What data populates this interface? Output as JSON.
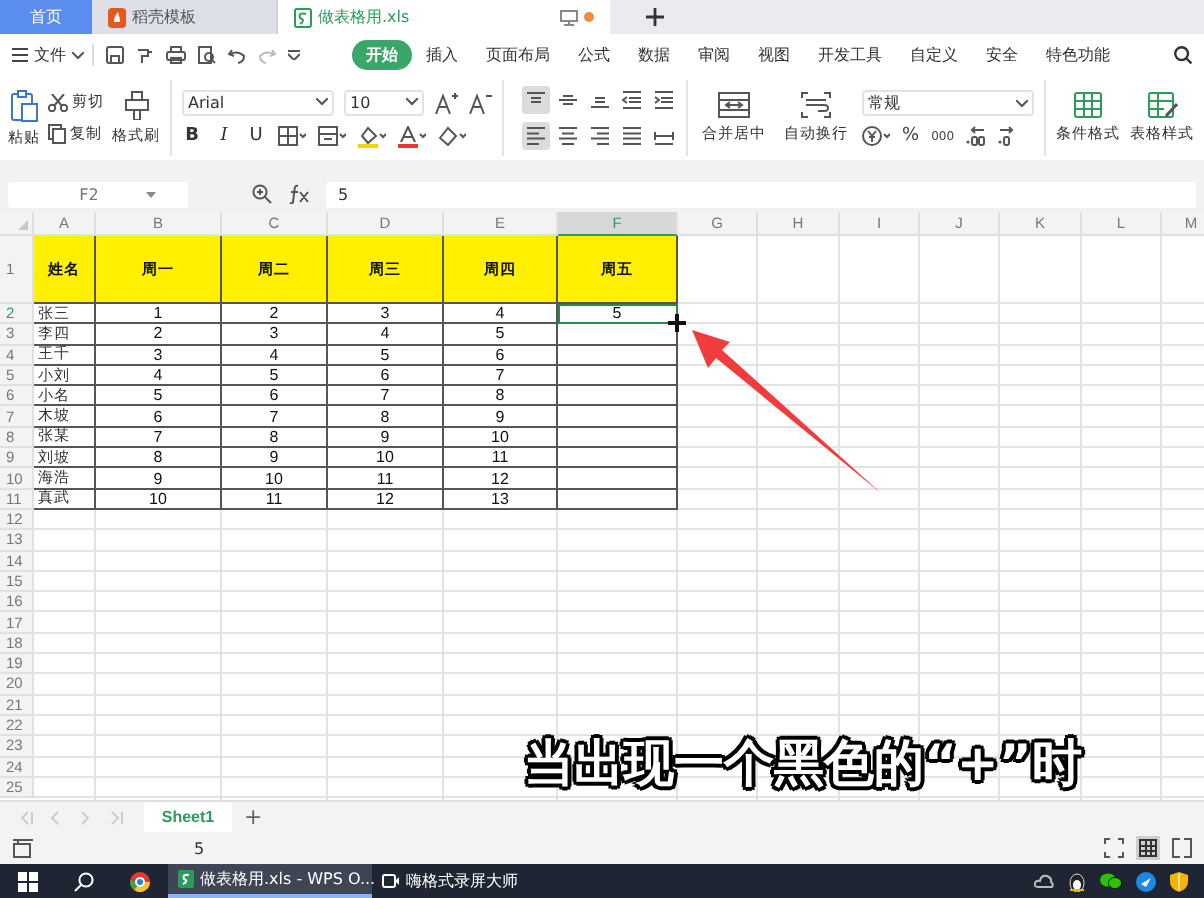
{
  "tabs": [
    {
      "label": "首页",
      "kind": "home",
      "selected": false
    },
    {
      "label": "稻壳模板",
      "kind": "template",
      "selected": false
    },
    {
      "label": "做表格用.xls",
      "kind": "sheet",
      "selected": true,
      "modified": true
    }
  ],
  "menu": {
    "file": "文件",
    "ribbon_tabs": [
      {
        "label": "开始",
        "selected": true
      },
      {
        "label": "插入",
        "selected": false
      },
      {
        "label": "页面布局",
        "selected": false
      },
      {
        "label": "公式",
        "selected": false
      },
      {
        "label": "数据",
        "selected": false
      },
      {
        "label": "审阅",
        "selected": false
      },
      {
        "label": "视图",
        "selected": false
      },
      {
        "label": "开发工具",
        "selected": false
      },
      {
        "label": "自定义",
        "selected": false
      },
      {
        "label": "安全",
        "selected": false
      },
      {
        "label": "特色功能",
        "selected": false
      }
    ]
  },
  "ribbon": {
    "paste": "粘贴",
    "cut": "剪切",
    "copy": "复制",
    "format_painter": "格式刷",
    "font": "Arial",
    "font_size": "10",
    "style_buttons": [
      {
        "label": "B",
        "kind": "bold"
      },
      {
        "label": "I",
        "kind": "italic"
      },
      {
        "label": "U",
        "kind": "underline"
      }
    ],
    "align_buttons": [
      {
        "kind": "top",
        "selected": true
      },
      {
        "kind": "middle",
        "selected": false
      },
      {
        "kind": "bottom",
        "selected": false
      },
      {
        "kind": "outdent",
        "selected": false
      },
      {
        "kind": "indent",
        "selected": false
      },
      {
        "kind": "left",
        "selected": true
      },
      {
        "kind": "center",
        "selected": false
      },
      {
        "kind": "right",
        "selected": false
      },
      {
        "kind": "justify",
        "selected": false
      },
      {
        "kind": "distribute",
        "selected": false
      }
    ],
    "merge": "合并居中",
    "wrap": "自动换行",
    "number_format": "常规",
    "percent": "%",
    "thousands": "000",
    "conditional_format": "条件格式",
    "table_style": "表格样式"
  },
  "formula_bar": {
    "name_box": "F2",
    "formula": "5"
  },
  "table": {
    "columns": [
      {
        "label": "A",
        "selected": false
      },
      {
        "label": "B",
        "selected": false
      },
      {
        "label": "C",
        "selected": false
      },
      {
        "label": "D",
        "selected": false
      },
      {
        "label": "E",
        "selected": false
      },
      {
        "label": "F",
        "selected": true
      },
      {
        "label": "G",
        "selected": false
      },
      {
        "label": "H",
        "selected": false
      },
      {
        "label": "I",
        "selected": false
      },
      {
        "label": "J",
        "selected": false
      },
      {
        "label": "K",
        "selected": false
      },
      {
        "label": "L",
        "selected": false
      },
      {
        "label": "M",
        "selected": false
      }
    ],
    "rows": [
      {
        "label": "1",
        "selected": false,
        "kind": "header",
        "cells": [
          "姓名",
          "周一",
          "周二",
          "周三",
          "周四",
          "周五"
        ]
      },
      {
        "label": "2",
        "selected": true,
        "kind": "data",
        "cells": [
          "张三",
          "1",
          "2",
          "3",
          "4",
          "5"
        ]
      },
      {
        "label": "3",
        "selected": false,
        "kind": "data",
        "cells": [
          "李四",
          "2",
          "3",
          "4",
          "5"
        ]
      },
      {
        "label": "4",
        "selected": false,
        "kind": "data",
        "cells": [
          "王千",
          "3",
          "4",
          "5",
          "6"
        ]
      },
      {
        "label": "5",
        "selected": false,
        "kind": "data",
        "cells": [
          "小刘",
          "4",
          "5",
          "6",
          "7"
        ]
      },
      {
        "label": "6",
        "selected": false,
        "kind": "data",
        "cells": [
          "小名",
          "5",
          "6",
          "7",
          "8"
        ]
      },
      {
        "label": "7",
        "selected": false,
        "kind": "data",
        "cells": [
          "木坡",
          "6",
          "7",
          "8",
          "9"
        ]
      },
      {
        "label": "8",
        "selected": false,
        "kind": "data",
        "cells": [
          "张某",
          "7",
          "8",
          "9",
          "10"
        ]
      },
      {
        "label": "9",
        "selected": false,
        "kind": "data",
        "cells": [
          "刘坡",
          "8",
          "9",
          "10",
          "11"
        ]
      },
      {
        "label": "10",
        "selected": false,
        "kind": "data",
        "cells": [
          "海浩",
          "9",
          "10",
          "11",
          "12"
        ]
      },
      {
        "label": "11",
        "selected": false,
        "kind": "data",
        "cells": [
          "真武",
          "10",
          "11",
          "12",
          "13"
        ]
      },
      {
        "label": "12",
        "selected": false
      },
      {
        "label": "13",
        "selected": false
      },
      {
        "label": "14",
        "selected": false
      },
      {
        "label": "15",
        "selected": false
      },
      {
        "label": "16",
        "selected": false
      },
      {
        "label": "17",
        "selected": false
      },
      {
        "label": "18",
        "selected": false
      },
      {
        "label": "19",
        "selected": false
      },
      {
        "label": "20",
        "selected": false
      },
      {
        "label": "21",
        "selected": false
      },
      {
        "label": "22",
        "selected": false
      },
      {
        "label": "23",
        "selected": false
      },
      {
        "label": "24",
        "selected": false
      },
      {
        "label": "25",
        "selected": false
      }
    ]
  },
  "caption": "当出现一个黑色的“+”时",
  "sheet_tabs": [
    {
      "label": "Sheet1",
      "selected": true
    }
  ],
  "add_sheet": "+",
  "status_bar": {
    "value": "5"
  },
  "taskbar": {
    "items": [
      {
        "label": "做表格用.xls - WPS O...",
        "kind": "wps",
        "selected": true
      },
      {
        "label": "嗨格式录屏大师",
        "kind": "recorder",
        "selected": false
      }
    ]
  }
}
